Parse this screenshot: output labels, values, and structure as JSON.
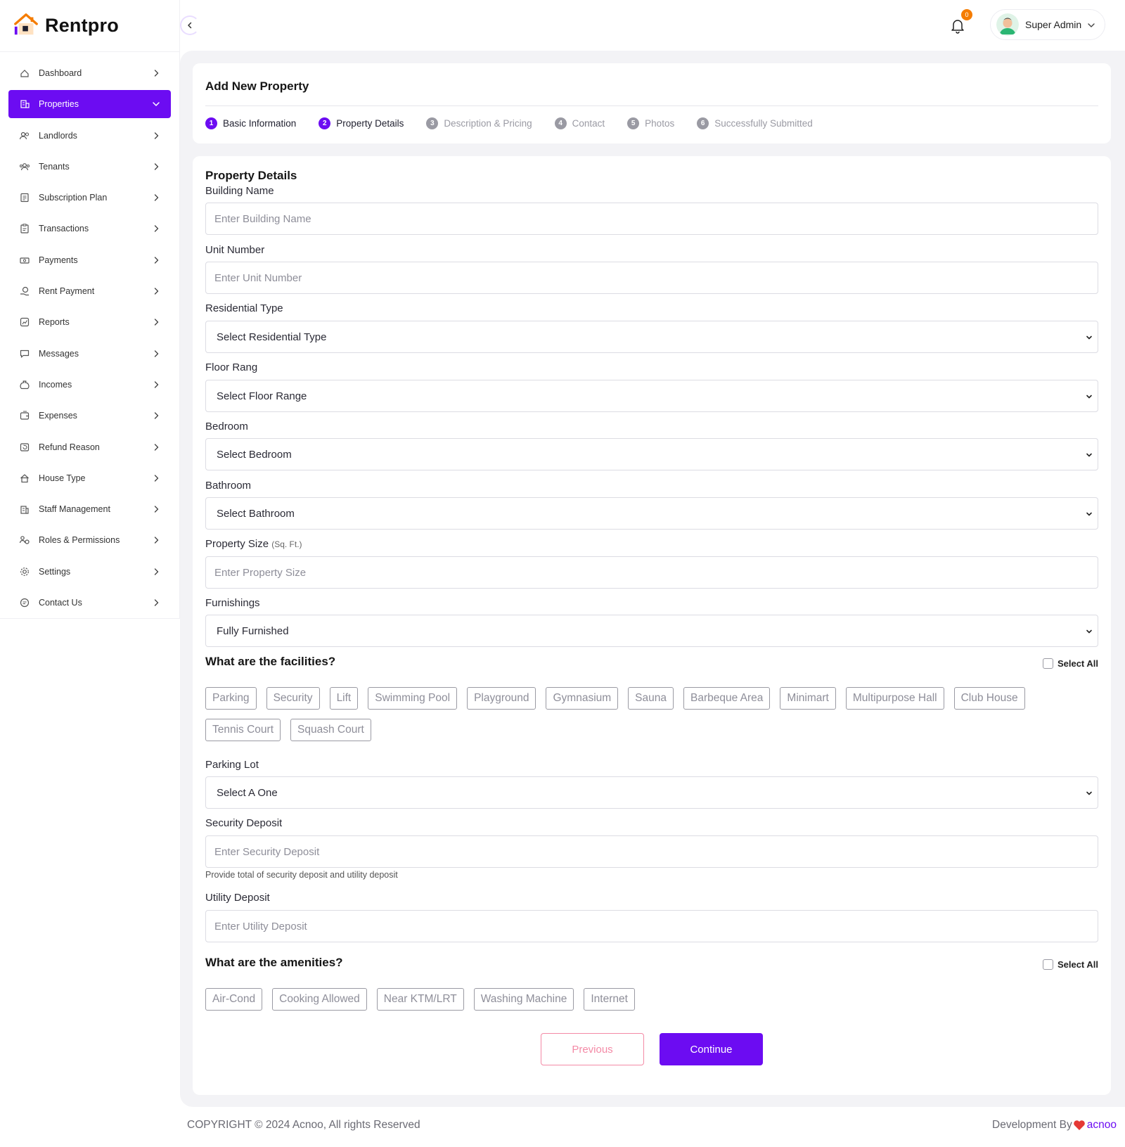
{
  "app": {
    "name": "Rentpro"
  },
  "sidebar": {
    "items": [
      {
        "label": "Dashboard",
        "icon": "dashboard-icon"
      },
      {
        "label": "Properties",
        "icon": "building-icon",
        "active": true
      },
      {
        "label": "Landlords",
        "icon": "users-icon"
      },
      {
        "label": "Tenants",
        "icon": "group-icon"
      },
      {
        "label": "Subscription Plan",
        "icon": "receipt-icon"
      },
      {
        "label": "Transactions",
        "icon": "clipboard-icon"
      },
      {
        "label": "Payments",
        "icon": "cash-icon"
      },
      {
        "label": "Rent Payment",
        "icon": "coin-hand-icon"
      },
      {
        "label": "Reports",
        "icon": "report-icon"
      },
      {
        "label": "Messages",
        "icon": "chat-icon"
      },
      {
        "label": "Incomes",
        "icon": "money-bag-icon"
      },
      {
        "label": "Expenses",
        "icon": "wallet-icon"
      },
      {
        "label": "Refund Reason",
        "icon": "refund-icon"
      },
      {
        "label": "House Type",
        "icon": "house-icon"
      },
      {
        "label": "Staff Management",
        "icon": "staff-icon"
      },
      {
        "label": "Roles & Permissions",
        "icon": "roles-icon"
      },
      {
        "label": "Settings",
        "icon": "gear-icon"
      },
      {
        "label": "Contact Us",
        "icon": "contact-icon"
      }
    ]
  },
  "topbar": {
    "notification_count": "0",
    "user_name": "Super Admin"
  },
  "header": {
    "title": "Add New Property",
    "steps": [
      {
        "num": "1",
        "label": "Basic Information",
        "state": "done"
      },
      {
        "num": "2",
        "label": "Property Details",
        "state": "current"
      },
      {
        "num": "3",
        "label": "Description & Pricing",
        "state": "pending"
      },
      {
        "num": "4",
        "label": "Contact",
        "state": "pending"
      },
      {
        "num": "5",
        "label": "Photos",
        "state": "pending"
      },
      {
        "num": "6",
        "label": "Successfully Submitted",
        "state": "pending"
      }
    ]
  },
  "form": {
    "section_title": "Property Details",
    "building_name": {
      "label": "Building Name",
      "placeholder": "Enter Building Name"
    },
    "unit_number": {
      "label": "Unit Number",
      "placeholder": "Enter Unit Number"
    },
    "residential_type": {
      "label": "Residential Type",
      "value": "Select Residential Type"
    },
    "floor_range": {
      "label": "Floor Rang",
      "value": "Select Floor Range"
    },
    "bedroom": {
      "label": "Bedroom",
      "value": "Select Bedroom"
    },
    "bathroom": {
      "label": "Bathroom",
      "value": "Select Bathroom"
    },
    "property_size": {
      "label": "Property Size",
      "unit": "(Sq. Ft.)",
      "placeholder": "Enter Property Size"
    },
    "furnishings": {
      "label": "Furnishings",
      "value": "Fully Furnished"
    },
    "facilities": {
      "title": "What are the facilities?",
      "select_all": "Select All",
      "options": [
        "Parking",
        "Security",
        "Lift",
        "Swimming Pool",
        "Playground",
        "Gymnasium",
        "Sauna",
        "Barbeque Area",
        "Minimart",
        "Multipurpose Hall",
        "Club House",
        "Tennis Court",
        "Squash Court"
      ]
    },
    "parking_lot": {
      "label": "Parking Lot",
      "value": "Select A One"
    },
    "security_deposit": {
      "label": "Security Deposit",
      "placeholder": "Enter Security Deposit",
      "help": "Provide total of security deposit and utility deposit"
    },
    "utility_deposit": {
      "label": "Utility Deposit",
      "placeholder": "Enter Utility Deposit"
    },
    "amenities": {
      "title": "What are the amenities?",
      "select_all": "Select All",
      "options": [
        "Air-Cond",
        "Cooking Allowed",
        "Near KTM/LRT",
        "Washing Machine",
        "Internet"
      ]
    },
    "previous_label": "Previous",
    "continue_label": "Continue"
  },
  "footer": {
    "copyright": "COPYRIGHT © 2024 Acnoo, All rights Reserved",
    "dev_prefix": "Development By",
    "dev_brand": "acnoo"
  },
  "colors": {
    "accent": "#6c0cf2",
    "previous_border": "#f48aa6",
    "badge": "#f57c00"
  }
}
